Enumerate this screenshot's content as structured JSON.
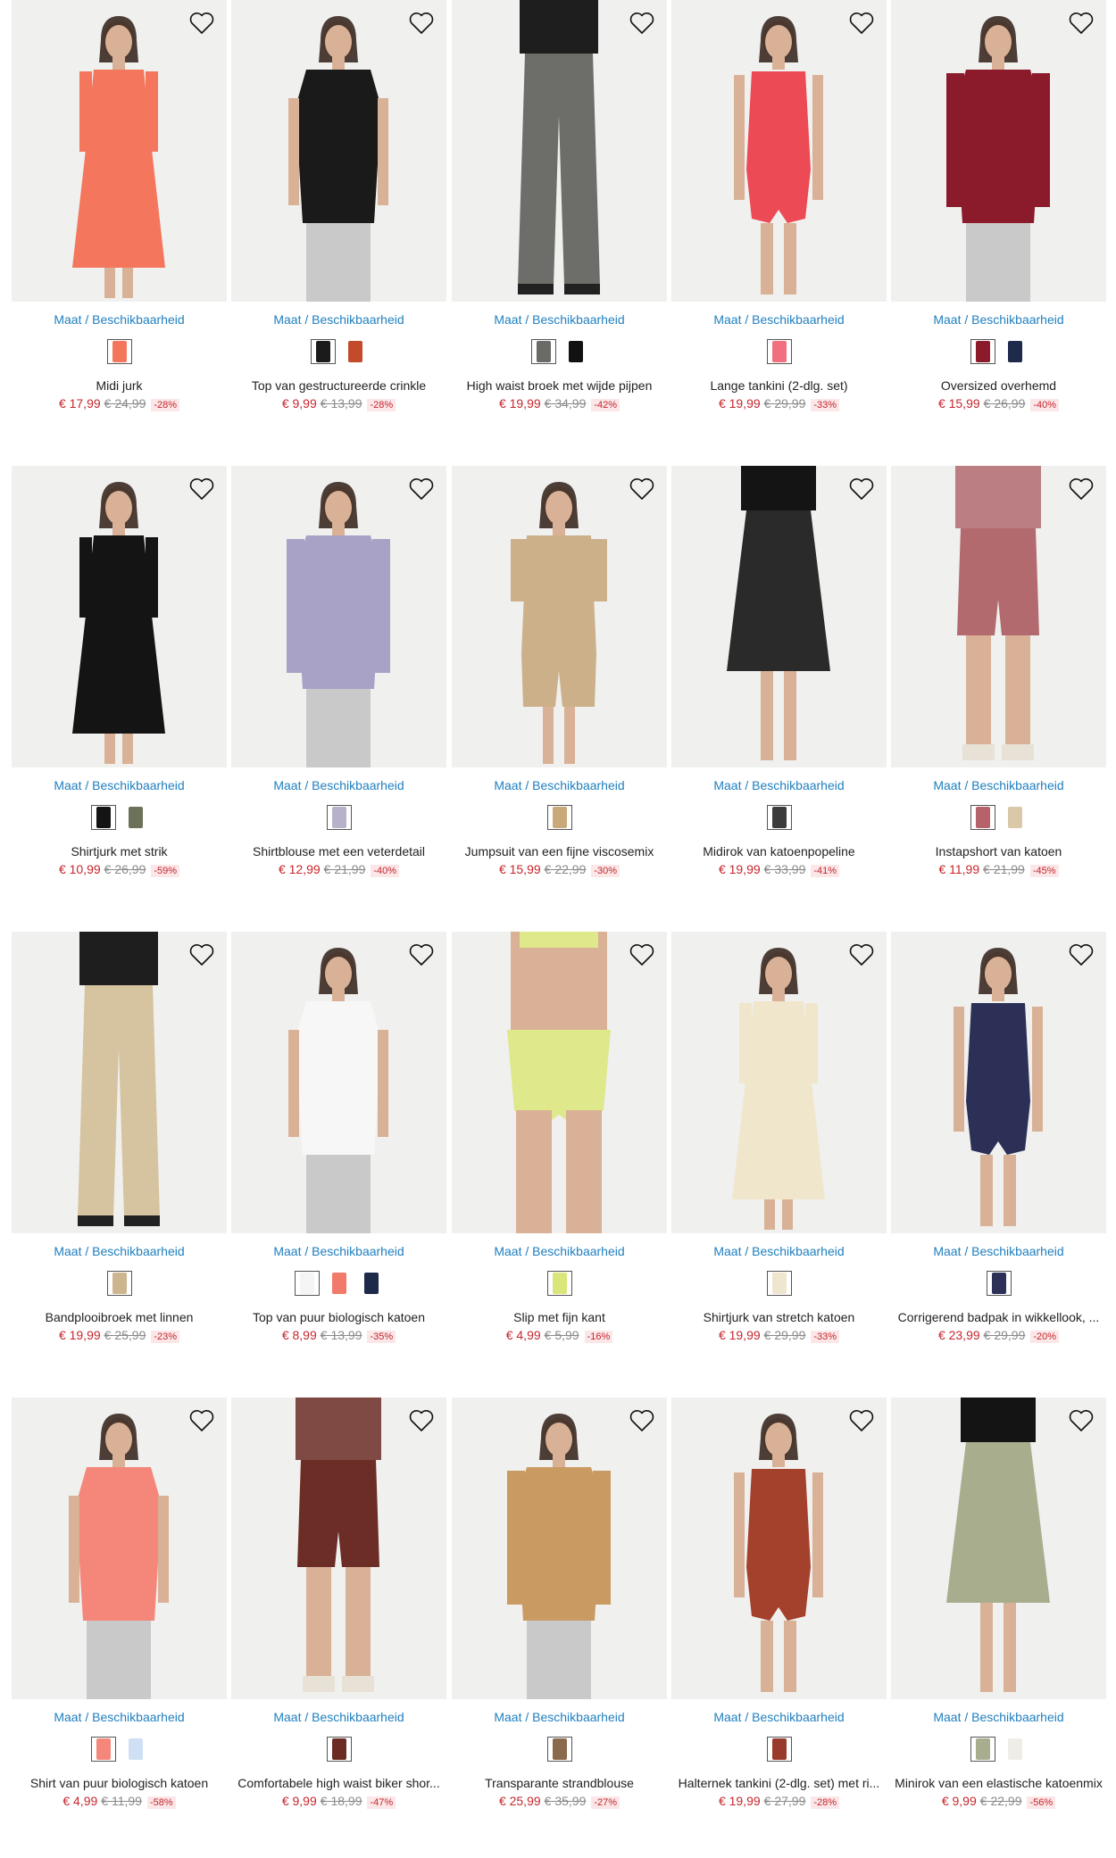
{
  "ui": {
    "availability_label": "Maat / Beschikbaarheid",
    "colors": {
      "link": "#1f7fbf",
      "sale_price": "#c5262d",
      "old_price": "#8a8a8a",
      "discount_bg": "#fbe7e8"
    }
  },
  "products": [
    {
      "name": "Midi jurk",
      "price": "€ 17,99",
      "old_price": "€ 24,99",
      "discount": "-28%",
      "swatches": [
        "#f4765c"
      ],
      "image": {
        "bg": "#f0f0ef",
        "garment": "#f4765c",
        "style": "dress"
      }
    },
    {
      "name": "Top van gestructureerde crinkle",
      "price": "€ 9,99",
      "old_price": "€ 13,99",
      "discount": "-28%",
      "swatches": [
        "#1b1b1b",
        "#c44a2c"
      ],
      "image": {
        "bg": "#f0f0ef",
        "garment": "#1a1a1a",
        "style": "top"
      }
    },
    {
      "name": "High waist broek met wijde pijpen",
      "price": "€ 19,99",
      "old_price": "€ 34,99",
      "discount": "-42%",
      "swatches": [
        "#6a6a66",
        "#111111"
      ],
      "image": {
        "bg": "#f0f0ef",
        "garment": "#6d6d69",
        "style": "pants"
      }
    },
    {
      "name": "Lange tankini (2-dlg. set)",
      "price": "€ 19,99",
      "old_price": "€ 29,99",
      "discount": "-33%",
      "swatches": [
        "#f07080"
      ],
      "image": {
        "bg": "#f0f0ef",
        "garment": "#ec4a55",
        "style": "swim"
      }
    },
    {
      "name": "Oversized overhemd",
      "price": "€ 15,99",
      "old_price": "€ 26,99",
      "discount": "-40%",
      "swatches": [
        "#8b1a2a",
        "#1d2a4a"
      ],
      "image": {
        "bg": "#f0f0ef",
        "garment": "#8b1a2a",
        "style": "shirt"
      }
    },
    {
      "name": "Shirtjurk met strik",
      "price": "€ 10,99",
      "old_price": "€ 26,99",
      "discount": "-59%",
      "swatches": [
        "#141414",
        "#6b7259"
      ],
      "image": {
        "bg": "#f0f0ef",
        "garment": "#141414",
        "style": "dress"
      }
    },
    {
      "name": "Shirtblouse met een veterdetail",
      "price": "€ 12,99",
      "old_price": "€ 21,99",
      "discount": "-40%",
      "swatches": [
        "#b7b2c9"
      ],
      "image": {
        "bg": "#f0f0ef",
        "garment": "#a7a2c6",
        "style": "blouse"
      }
    },
    {
      "name": "Jumpsuit van een fijne viscosemix",
      "price": "€ 15,99",
      "old_price": "€ 22,99",
      "discount": "-30%",
      "swatches": [
        "#c9a87a"
      ],
      "image": {
        "bg": "#f0f0ef",
        "garment": "#ccb08a",
        "style": "jumpsuit"
      }
    },
    {
      "name": "Midirok van katoenpopeline",
      "price": "€ 19,99",
      "old_price": "€ 33,99",
      "discount": "-41%",
      "swatches": [
        "#3c3c3c"
      ],
      "image": {
        "bg": "#f0f0ef",
        "garment": "#2a2a2a",
        "style": "skirt"
      }
    },
    {
      "name": "Instapshort van katoen",
      "price": "€ 11,99",
      "old_price": "€ 21,99",
      "discount": "-45%",
      "swatches": [
        "#b5626a",
        "#d9c9a8"
      ],
      "image": {
        "bg": "#f0f0ef",
        "garment": "#b26a6e",
        "style": "shorts"
      }
    },
    {
      "name": "Bandplooibroek met linnen",
      "price": "€ 19,99",
      "old_price": "€ 25,99",
      "discount": "-23%",
      "swatches": [
        "#cdb58f"
      ],
      "image": {
        "bg": "#f0f0ef",
        "garment": "#d6c39f",
        "style": "pants"
      }
    },
    {
      "name": "Top van puur biologisch katoen",
      "price": "€ 8,99",
      "old_price": "€ 13,99",
      "discount": "-35%",
      "swatches": [
        "#f5f5f5",
        "#f27a6a",
        "#1d2a4a"
      ],
      "image": {
        "bg": "#f0f0ef",
        "garment": "#f7f7f7",
        "style": "top"
      }
    },
    {
      "name": "Slip met fijn kant",
      "price": "€ 4,99",
      "old_price": "€ 5,99",
      "discount": "-16%",
      "swatches": [
        "#d9e77a"
      ],
      "image": {
        "bg": "#f0f0ef",
        "garment": "#dfe88a",
        "style": "brief"
      }
    },
    {
      "name": "Shirtjurk van stretch katoen",
      "price": "€ 19,99",
      "old_price": "€ 29,99",
      "discount": "-33%",
      "swatches": [
        "#efe6cf"
      ],
      "image": {
        "bg": "#f0f0ef",
        "garment": "#f0e6cc",
        "style": "dress"
      }
    },
    {
      "name": "Corrigerend badpak in wikkellook, ...",
      "price": "€ 23,99",
      "old_price": "€ 29,99",
      "discount": "-20%",
      "swatches": [
        "#2d3158"
      ],
      "image": {
        "bg": "#f0f0ef",
        "garment": "#2c3056",
        "style": "swim"
      }
    },
    {
      "name": "Shirt van puur biologisch katoen",
      "price": "€ 4,99",
      "old_price": "€ 11,99",
      "discount": "-58%",
      "swatches": [
        "#f5877a",
        "#cfe0f5"
      ],
      "image": {
        "bg": "#f0f0ef",
        "garment": "#f4877a",
        "style": "top"
      }
    },
    {
      "name": "Comfortabele high waist biker shor...",
      "price": "€ 9,99",
      "old_price": "€ 18,99",
      "discount": "-47%",
      "swatches": [
        "#6b2b23"
      ],
      "image": {
        "bg": "#f0f0ef",
        "garment": "#6b2d25",
        "style": "shorts"
      }
    },
    {
      "name": "Transparante strandblouse",
      "price": "€ 25,99",
      "old_price": "€ 35,99",
      "discount": "-27%",
      "swatches": [
        "#8a6a4a"
      ],
      "image": {
        "bg": "#f0f0ef",
        "garment": "#c99a62",
        "style": "blouse"
      }
    },
    {
      "name": "Halternek tankini (2-dlg. set) met ri...",
      "price": "€ 19,99",
      "old_price": "€ 27,99",
      "discount": "-28%",
      "swatches": [
        "#9a3a2a"
      ],
      "image": {
        "bg": "#f0f0ef",
        "garment": "#a4412c",
        "style": "swim"
      }
    },
    {
      "name": "Minirok van een elastische katoenmix",
      "price": "€ 9,99",
      "old_price": "€ 22,99",
      "discount": "-56%",
      "swatches": [
        "#a8ad8e",
        "#efeee6"
      ],
      "image": {
        "bg": "#f0f0ef",
        "garment": "#a8ad8e",
        "style": "skirt"
      }
    }
  ]
}
